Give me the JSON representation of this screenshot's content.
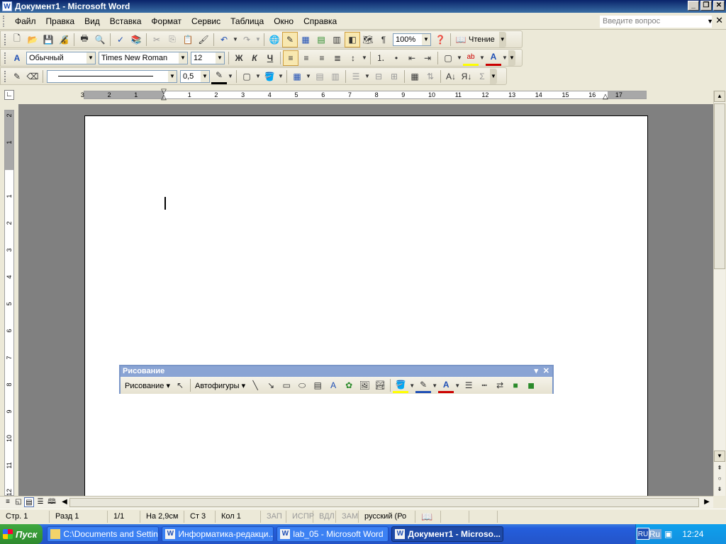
{
  "window": {
    "title": "Документ1 - Microsoft Word",
    "icon": "word-doc-icon"
  },
  "menu": {
    "items": [
      "Файл",
      "Правка",
      "Вид",
      "Вставка",
      "Формат",
      "Сервис",
      "Таблица",
      "Окно",
      "Справка"
    ],
    "ask_placeholder": "Введите вопрос"
  },
  "toolbar_standard": {
    "zoom": "100%",
    "reading_label": "Чтение"
  },
  "toolbar_format": {
    "style": "Обычный",
    "font": "Times New Roman",
    "size": "12"
  },
  "toolbar_tables": {
    "line_weight": "0,5"
  },
  "ruler": {
    "h_numbers": [
      "3",
      "2",
      "1",
      "1",
      "2",
      "3",
      "4",
      "5",
      "6",
      "7",
      "8",
      "9",
      "10",
      "11",
      "12",
      "13",
      "14",
      "15",
      "16",
      "17"
    ],
    "v_numbers": [
      "2",
      "1",
      "1",
      "2",
      "3",
      "4",
      "5",
      "6",
      "7",
      "8",
      "9",
      "10",
      "11",
      "12"
    ]
  },
  "drawing_toolbar": {
    "title": "Рисование",
    "draw_menu": "Рисование",
    "autoshapes": "Автофигуры"
  },
  "status": {
    "page": "Стр. 1",
    "section": "Разд 1",
    "pages": "1/1",
    "at": "На 2,9см",
    "line": "Ст 3",
    "col": "Кол 1",
    "rec": "ЗАП",
    "trk": "ИСПР",
    "ext": "ВДЛ",
    "ovr": "ЗАМ",
    "lang": "русский (Ро"
  },
  "taskbar": {
    "start": "Пуск",
    "tasks": [
      {
        "label": "C:\\Documents and Settin...",
        "icon": "folder-icon",
        "active": false
      },
      {
        "label": "Информатика-редакци...",
        "icon": "word-icon",
        "active": false
      },
      {
        "label": "lab_05 - Microsoft Word",
        "icon": "word-icon",
        "active": false
      },
      {
        "label": "Документ1 - Microso...",
        "icon": "word-icon",
        "active": true
      }
    ],
    "lang": "RU",
    "tray_lang": "Ru",
    "clock": "12:24"
  }
}
